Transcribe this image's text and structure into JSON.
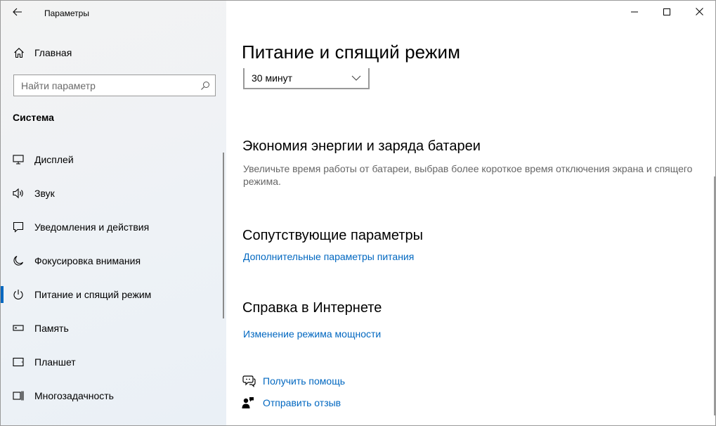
{
  "app": {
    "title": "Параметры"
  },
  "sidebar": {
    "home_label": "Главная",
    "search_placeholder": "Найти параметр",
    "section_title": "Система",
    "items": [
      {
        "label": "Дисплей",
        "icon": "monitor-icon"
      },
      {
        "label": "Звук",
        "icon": "speaker-icon"
      },
      {
        "label": "Уведомления и действия",
        "icon": "notification-icon"
      },
      {
        "label": "Фокусировка внимания",
        "icon": "moon-icon"
      },
      {
        "label": "Питание и спящий режим",
        "icon": "power-icon",
        "active": true
      },
      {
        "label": "Память",
        "icon": "storage-icon"
      },
      {
        "label": "Планшет",
        "icon": "tablet-icon"
      },
      {
        "label": "Многозадачность",
        "icon": "multitasking-icon"
      }
    ]
  },
  "main": {
    "title": "Питание и спящий режим",
    "sleep_dropdown_value": "30 минут",
    "battery": {
      "heading": "Экономия энергии и заряда батареи",
      "description": "Увеличьте время работы от батареи, выбрав более короткое время отключения экрана и спящего режима."
    },
    "related": {
      "heading": "Сопутствующие параметры",
      "link": "Дополнительные параметры питания"
    },
    "web_help": {
      "heading": "Справка в Интернете",
      "link": "Изменение режима мощности"
    },
    "get_help": "Получить помощь",
    "feedback": "Отправить отзыв"
  },
  "colors": {
    "accent": "#0067c0",
    "sidebar_bg": "#f2f2f2"
  }
}
